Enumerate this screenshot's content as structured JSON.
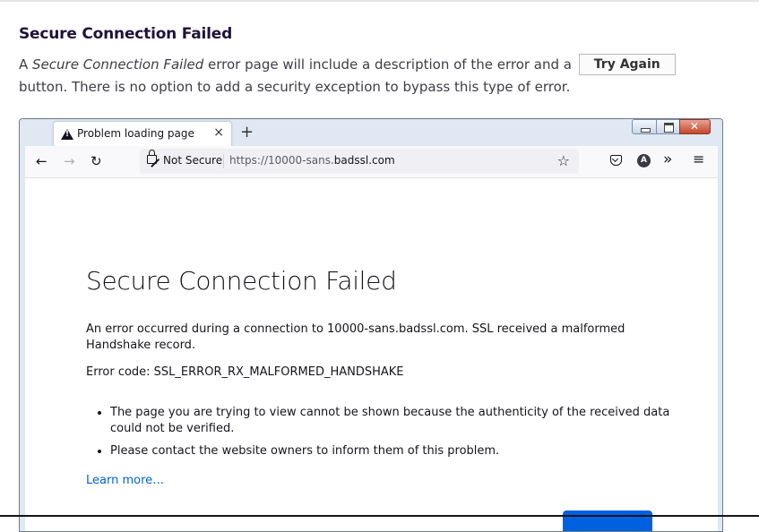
{
  "doc": {
    "heading": "Secure Connection Failed",
    "para_prefix": "A ",
    "para_em": "Secure Connection Failed",
    "para_mid": " error page will include a description of the error and a",
    "try_again": "Try Again",
    "para_suffix": "button. There is no option to add a security exception to bypass this type of error."
  },
  "browser": {
    "tab_title": "Problem loading page",
    "tab_close": "×",
    "new_tab": "+",
    "nav": {
      "back": "←",
      "forward": "→",
      "reload": "↻"
    },
    "urlbar": {
      "security_label": "Not Secure",
      "url_prefix": "https://10000-sans.",
      "url_domain": "badssl.com"
    },
    "star": "☆",
    "account_initial": "A",
    "overflow": "»",
    "menu": "≡"
  },
  "error_page": {
    "title": "Secure Connection Failed",
    "description": "An error occurred during a connection to 10000-sans.badssl.com. SSL received a malformed Handshake record.",
    "error_code": "Error code: SSL_ERROR_RX_MALFORMED_HANDSHAKE",
    "bullets": [
      "The page you are trying to view cannot be shown because the authenticity of the received data could not be verified.",
      "Please contact the website owners to inform them of this problem."
    ],
    "learn_more": "Learn more…"
  },
  "colors": {
    "heading": "#20123a",
    "link": "#0061e0",
    "close_button": "#c4452b"
  }
}
